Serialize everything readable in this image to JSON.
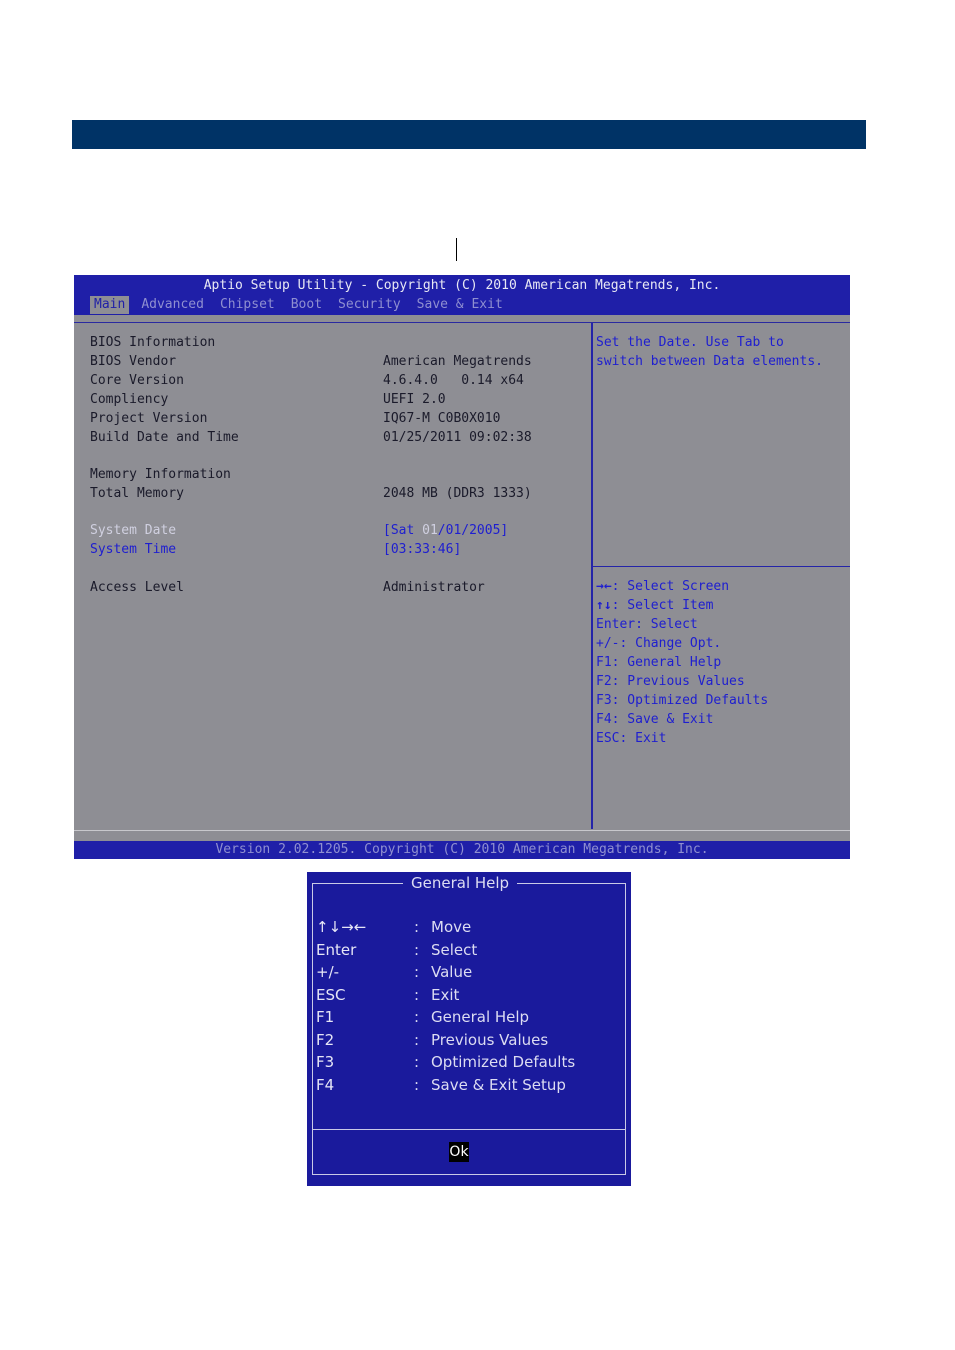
{
  "bios": {
    "title": "Aptio Setup Utility - Copyright (C) 2010 American Megatrends, Inc.",
    "menu": [
      "Main",
      "Advanced",
      "Chipset",
      "Boot",
      "Security",
      "Save & Exit"
    ],
    "rows": {
      "bios_info": "BIOS Information",
      "bios_vendor_label": "BIOS Vendor",
      "bios_vendor_value": "American Megatrends",
      "core_version_label": "Core Version",
      "core_version_value": "4.6.4.0   0.14 x64",
      "compliency_label": "Compliency",
      "compliency_value": "UEFI 2.0",
      "project_version_label": "Project Version",
      "project_version_value": "IQ67-M C0B0X010",
      "build_date_label": "Build Date and Time",
      "build_date_value": "01/25/2011 09:02:38",
      "memory_info": "Memory Information",
      "total_memory_label": "Total Memory",
      "total_memory_value": "2048 MB (DDR3 1333)",
      "system_date_label": "System Date",
      "system_date_prefix": "[Sat ",
      "system_date_month": "01",
      "system_date_rest": "/01/2005]",
      "system_time_label": "System Time",
      "system_time_value": "[03:33:46]",
      "access_level_label": "Access Level",
      "access_level_value": "Administrator"
    },
    "help_text": [
      "Set the Date. Use Tab to",
      "switch between Data elements."
    ],
    "key_help": [
      {
        "key": "→←",
        "desc": ": Select Screen"
      },
      {
        "key": "↑↓",
        "desc": ": Select Item"
      },
      {
        "key": "",
        "desc": "Enter: Select"
      },
      {
        "key": "",
        "desc": "+/-: Change Opt."
      },
      {
        "key": "",
        "desc": "F1: General Help"
      },
      {
        "key": "",
        "desc": "F2: Previous Values"
      },
      {
        "key": "",
        "desc": "F3: Optimized Defaults"
      },
      {
        "key": "",
        "desc": "F4: Save & Exit"
      },
      {
        "key": "",
        "desc": "ESC: Exit"
      }
    ],
    "footer": "Version 2.02.1205. Copyright (C) 2010 American Megatrends, Inc."
  },
  "dialog": {
    "title": "General Help",
    "items": [
      {
        "key": "↑↓→←",
        "value": "Move"
      },
      {
        "key": "Enter",
        "value": "Select"
      },
      {
        "key": "+/-",
        "value": "Value"
      },
      {
        "key": "ESC",
        "value": "Exit"
      },
      {
        "key": "F1",
        "value": "General Help"
      },
      {
        "key": "F2",
        "value": "Previous Values"
      },
      {
        "key": "F3",
        "value": "Optimized Defaults"
      },
      {
        "key": "F4",
        "value": "Save & Exit Setup"
      }
    ],
    "ok_label": "Ok"
  },
  "colors": {
    "header_blue": "#003366",
    "bios_blue": "#1f1fa8",
    "bios_gray": "#8e8e94"
  }
}
